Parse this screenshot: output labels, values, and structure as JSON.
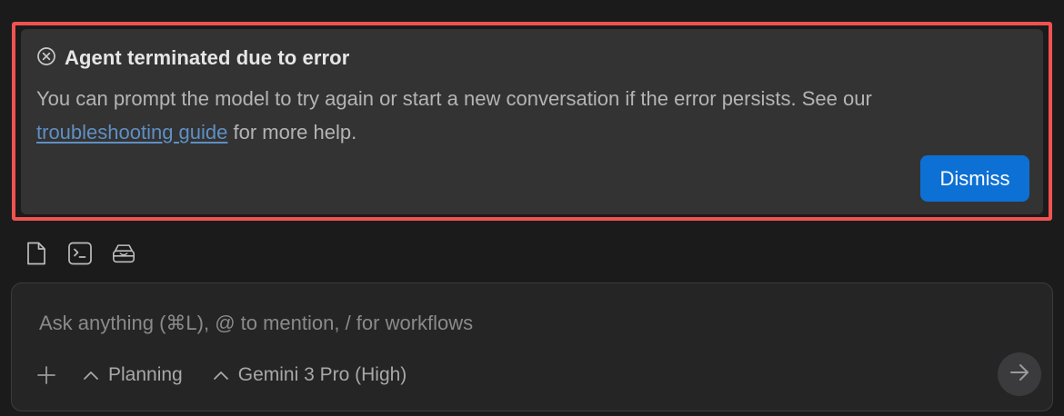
{
  "error_card": {
    "title": "Agent terminated due to error",
    "body_text": "You can prompt the model to try again or start a new conversation if the error persists. See our",
    "link_text": "troubleshooting guide",
    "body_suffix": " for more help.",
    "dismiss_label": "Dismiss",
    "icon": "circle-x-icon"
  },
  "toolbar": {
    "icons": [
      "file-icon",
      "terminal-icon",
      "inbox-icon"
    ]
  },
  "composer": {
    "placeholder": "Ask anything (⌘L), @ to mention, / for workflows",
    "mode_label": "Planning",
    "model_label": "Gemini 3 Pro (High)",
    "add_icon": "plus-icon",
    "send_icon": "arrow-right-icon"
  },
  "colors": {
    "background": "#1b1b1b",
    "card_background": "#333333",
    "highlight_border": "#f05252",
    "accent_button": "#0d70d4",
    "link": "#5f8fc4"
  }
}
